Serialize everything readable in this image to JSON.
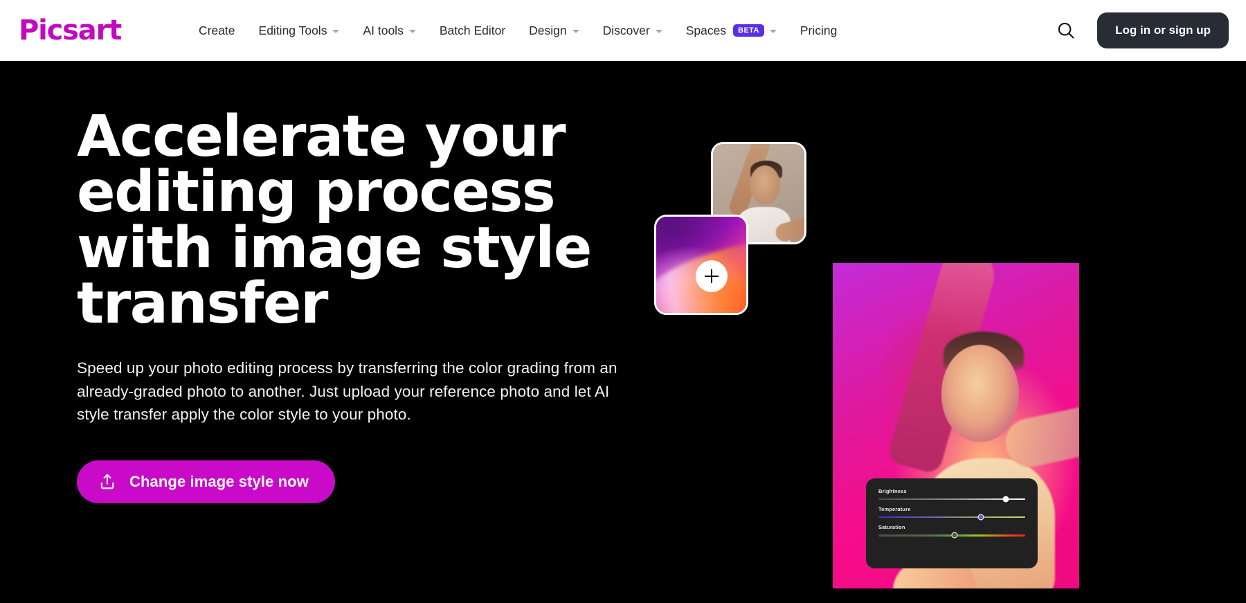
{
  "brand": {
    "name": "Picsart",
    "logo_color": "#C209C1"
  },
  "nav": {
    "items": [
      {
        "label": "Create",
        "has_dropdown": false,
        "badge": null
      },
      {
        "label": "Editing Tools",
        "has_dropdown": true,
        "badge": null
      },
      {
        "label": "AI tools",
        "has_dropdown": true,
        "badge": null
      },
      {
        "label": "Batch Editor",
        "has_dropdown": false,
        "badge": null
      },
      {
        "label": "Design",
        "has_dropdown": true,
        "badge": null
      },
      {
        "label": "Discover",
        "has_dropdown": true,
        "badge": null
      },
      {
        "label": "Spaces",
        "has_dropdown": true,
        "badge": "BETA"
      },
      {
        "label": "Pricing",
        "has_dropdown": false,
        "badge": null
      }
    ],
    "search_icon": "search-icon",
    "login_label": "Log in or sign up",
    "login_bg": "#282C34",
    "badge_color": "#5B2EE6"
  },
  "hero": {
    "headline": "Accelerate your editing process with image style transfer",
    "subcopy": "Speed up your photo editing process by transferring the color grading from an already-graded photo to another. Just upload your reference photo and let AI style transfer apply the color style to your photo.",
    "cta_label": "Change image style now",
    "cta_icon": "upload-icon",
    "cta_color": "#C90BC9",
    "background": "#000000",
    "text_color": "#FFFFFF"
  },
  "collage": {
    "plus_icon": "plus-icon",
    "reference_card_alt": "reference-photo-card",
    "style_card_alt": "style-swatch-card",
    "main_image_alt": "styled-result-photo"
  },
  "edit_panel": {
    "background": "#212121",
    "sliders": [
      {
        "label": "Brightness",
        "value": 87,
        "thumb_color": "#FFFFFF"
      },
      {
        "label": "Temperature",
        "value": 70,
        "thumb_color": "#6A64B8"
      },
      {
        "label": "Saturation",
        "value": 52,
        "thumb_color": "#56603F"
      }
    ]
  }
}
